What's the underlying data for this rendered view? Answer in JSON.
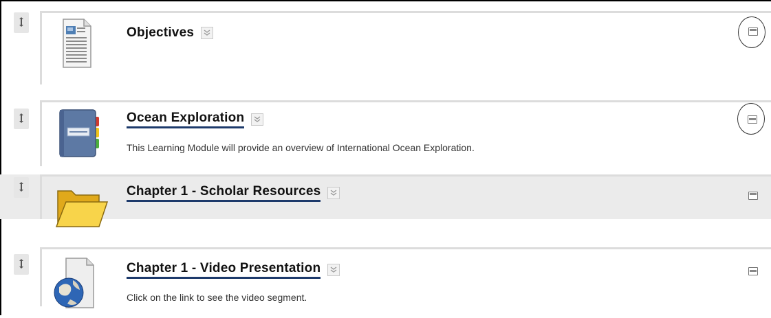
{
  "items": [
    {
      "title": "Objectives",
      "description": "",
      "icon": "document-icon",
      "toggle": "maximize-icon",
      "is_link": false
    },
    {
      "title": "Ocean Exploration",
      "description": "This Learning Module will provide an overview of International Ocean Exploration.",
      "icon": "learning-module-book-icon",
      "toggle": "minimize-icon",
      "is_link": true
    },
    {
      "title": "Chapter 1 - Scholar Resources",
      "description": "",
      "icon": "folder-icon",
      "toggle": "maximize-icon",
      "is_link": true
    },
    {
      "title": "Chapter 1 - Video Presentation",
      "description": "Click on the link to see the video segment.",
      "icon": "web-link-globe-icon",
      "toggle": "minimize-icon",
      "is_link": true
    }
  ],
  "icons": {
    "drag": "drag-handle-icon",
    "menu": "chevron-down-icon"
  },
  "colors": {
    "link_underline": "#1d3a6b",
    "highlight_row": "#ebebeb",
    "folder": "#f5c52b"
  }
}
